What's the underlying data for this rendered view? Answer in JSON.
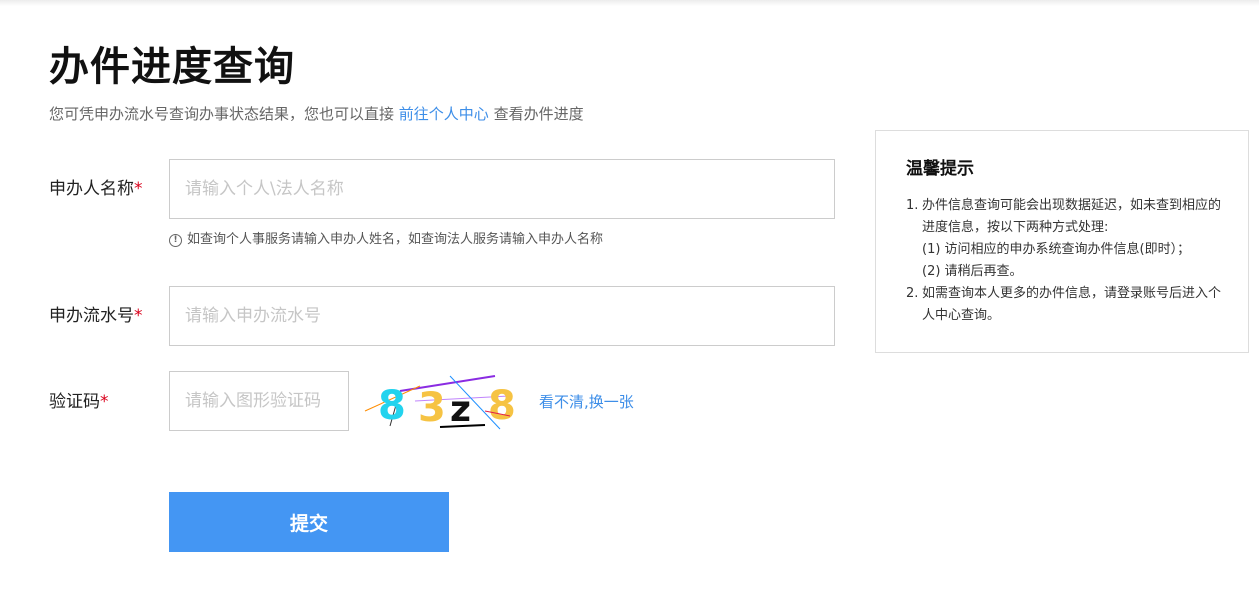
{
  "page": {
    "title": "办件进度查询",
    "subtitle_prefix": "您可凭申办流水号查询办事状态结果，您也可以直接 ",
    "subtitle_link": "前往个人中心",
    "subtitle_suffix": " 查看办件进度"
  },
  "form": {
    "name": {
      "label": "申办人名称",
      "required_mark": "*",
      "placeholder": "请输入个人\\法人名称",
      "value": "",
      "hint": "如查询个人事服务请输入申办人姓名，如查询法人服务请输入申办人名称",
      "hint_icon": "info-circle-icon"
    },
    "serial": {
      "label": "申办流水号",
      "required_mark": "*",
      "placeholder": "请输入申办流水号",
      "value": ""
    },
    "captcha": {
      "label": "验证码",
      "required_mark": "*",
      "placeholder": "请输入图形验证码",
      "value": "",
      "image_chars": [
        "8",
        "3",
        "z",
        "8"
      ],
      "refresh_label": "看不清,换一张"
    },
    "submit_label": "提交"
  },
  "tips": {
    "title": "温馨提示",
    "items": [
      {
        "num": "1.",
        "text": "办件信息查询可能会出现数据延迟，如未查到相应的进度信息，按以下两种方式处理:",
        "subs": [
          "(1) 访问相应的申办系统查询办件信息(即时）；",
          "(2) 请稍后再查。"
        ]
      },
      {
        "num": "2.",
        "text": "如需查询本人更多的办件信息，请登录账号后进入个人中心查询。",
        "subs": []
      }
    ]
  },
  "colors": {
    "accent": "#4496f3",
    "link": "#3d8ee8",
    "required": "#d9001b"
  }
}
